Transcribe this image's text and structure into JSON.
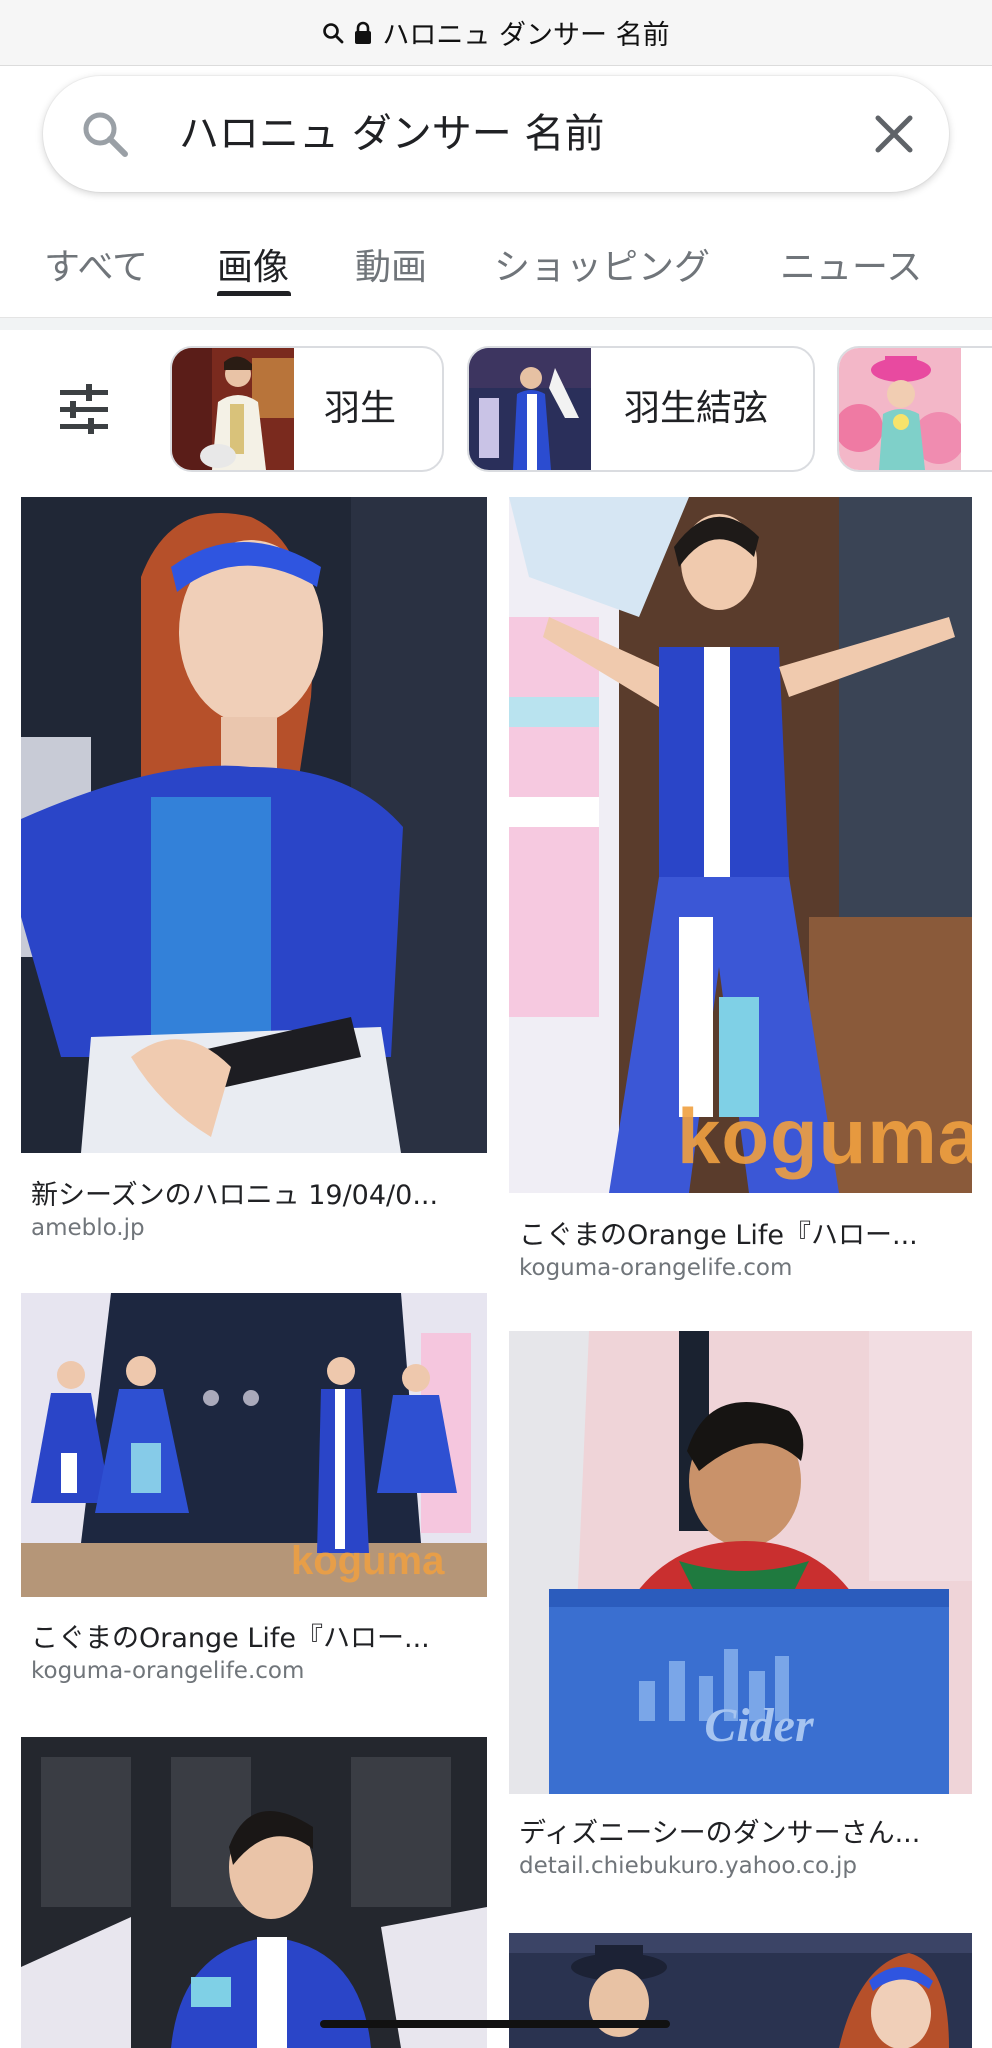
{
  "url_bar": {
    "url": "ハロニュ ダンサー 名前",
    "search_icon": "search-icon",
    "lock_icon": "lock-icon"
  },
  "search": {
    "query": "ハロニュ ダンサー 名前",
    "search_icon": "search-icon",
    "clear_icon": "close-icon"
  },
  "tabs": [
    {
      "label": "すべて",
      "active": false
    },
    {
      "label": "画像",
      "active": true
    },
    {
      "label": "動画",
      "active": false
    },
    {
      "label": "ショッピング",
      "active": false
    },
    {
      "label": "ニュース",
      "active": false
    }
  ],
  "chips": {
    "filter_icon": "tune-icon",
    "items": [
      {
        "label": "羽生"
      },
      {
        "label": "羽生結弦"
      },
      {
        "label": ""
      }
    ]
  },
  "results": [
    {
      "title": "新シーズンのハロニュ 19/04/0...",
      "domain": "ameblo.jp"
    },
    {
      "title": "こぐまのOrange Life『ハロー...",
      "domain": "koguma-orangelife.com",
      "watermark": "koguma"
    },
    {
      "title": "こぐまのOrange Life『ハロー...",
      "domain": "koguma-orangelife.com",
      "watermark": "koguma"
    },
    {
      "title": "ディズニーシーのダンサーさん...",
      "domain": "detail.chiebukuro.yahoo.co.jp",
      "crate_text": "Cider"
    },
    {
      "title": "",
      "domain": ""
    },
    {
      "title": "",
      "domain": ""
    }
  ],
  "colors": {
    "accent": "#202124",
    "muted": "#70757a",
    "costume_blue": "#2a45c8"
  }
}
